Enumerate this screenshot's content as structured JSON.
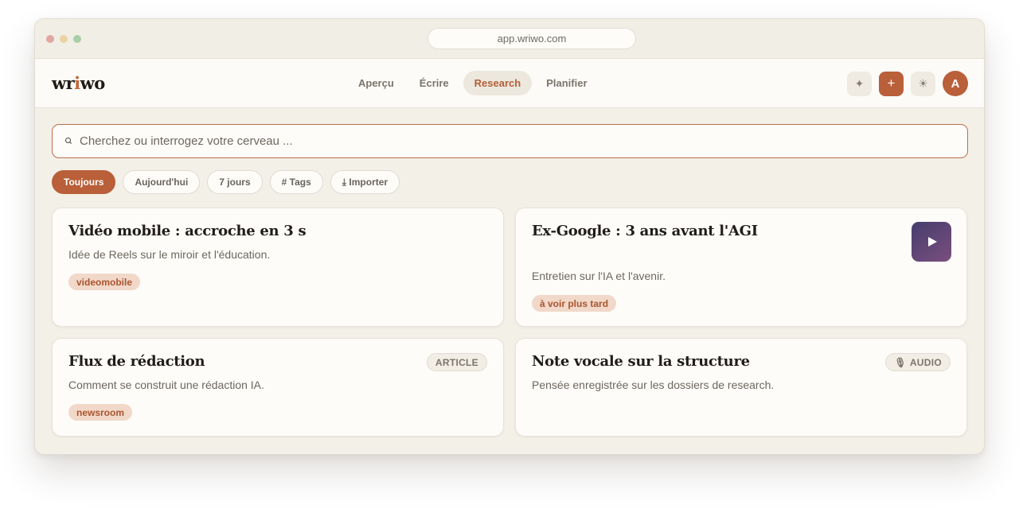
{
  "browser": {
    "url": "app.wriwo.com"
  },
  "header": {
    "logo_text_start": "wr",
    "logo_accent": "i",
    "logo_text_end": "wo",
    "nav": [
      "Aperçu",
      "Écrire",
      "Research",
      "Planifier"
    ],
    "active_nav": "Research",
    "actions": {
      "sparkle_icon": "✦",
      "add_icon": "+",
      "theme_icon": "☀",
      "avatar_initial": "A"
    }
  },
  "search": {
    "placeholder": "Cherchez ou interrogez votre cerveau ..."
  },
  "filters": {
    "items": [
      "Toujours",
      "Aujourd'hui",
      "7 jours",
      "# Tags",
      "⤓ Importer"
    ],
    "active": "Toujours"
  },
  "cards": [
    {
      "title": "Vidéo mobile : accroche en 3 s",
      "description": "Idée de Reels sur le miroir et l'éducation.",
      "tag": "videomobile"
    },
    {
      "title": "Ex-Google : 3 ans avant l'AGI",
      "description": "Entretien sur l'IA et l'avenir.",
      "tag": "à voir plus tard",
      "media": "video"
    },
    {
      "title": "Flux de rédaction",
      "description": "Comment se construit une rédaction IA.",
      "tag": "newsroom",
      "badge": "ARTICLE"
    },
    {
      "title": "Note vocale sur la structure",
      "description": "Pensée enregistrée sur les dossiers de research.",
      "badge": "AUDIO",
      "badge_icon": "🎙"
    }
  ],
  "colors": {
    "accent": "#b95f39",
    "background": "#f3f0e8",
    "card": "#fdfcf9",
    "tag_bg": "#f1d8c9",
    "tag_text": "#a9552f"
  }
}
